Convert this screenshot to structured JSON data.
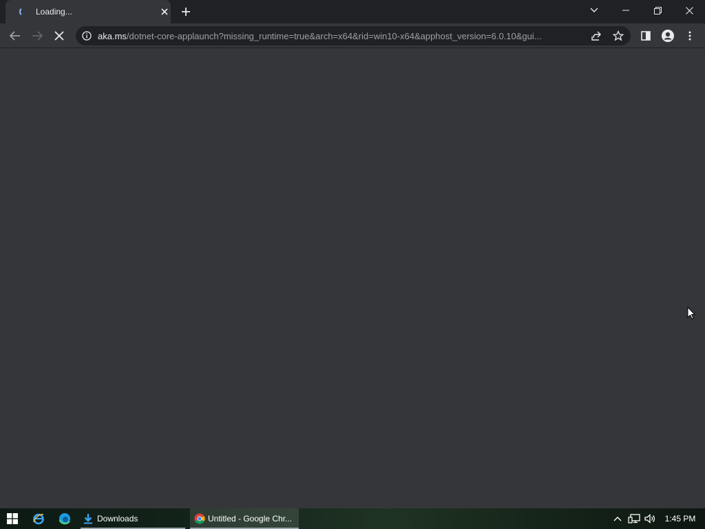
{
  "browser": {
    "tab": {
      "title": "Loading...",
      "icon": "loading-spinner-icon"
    },
    "toolbar": {
      "url_host": "aka.ms",
      "url_path": "/dotnet-core-applaunch?missing_runtime=true&arch=x64&rid=win10-x64&apphost_version=6.0.10&gui..."
    }
  },
  "taskbar": {
    "apps": [
      {
        "label": "Downloads",
        "icon": "download-folder-icon"
      },
      {
        "label": "Untitled - Google Chr...",
        "icon": "chrome-icon"
      }
    ],
    "clock": "1:45 PM"
  },
  "colors": {
    "tabstrip": "#202124",
    "toolbar": "#35363a",
    "omnibox": "#202124",
    "page_background": "#35363a",
    "accent": "#8ab4f8"
  }
}
